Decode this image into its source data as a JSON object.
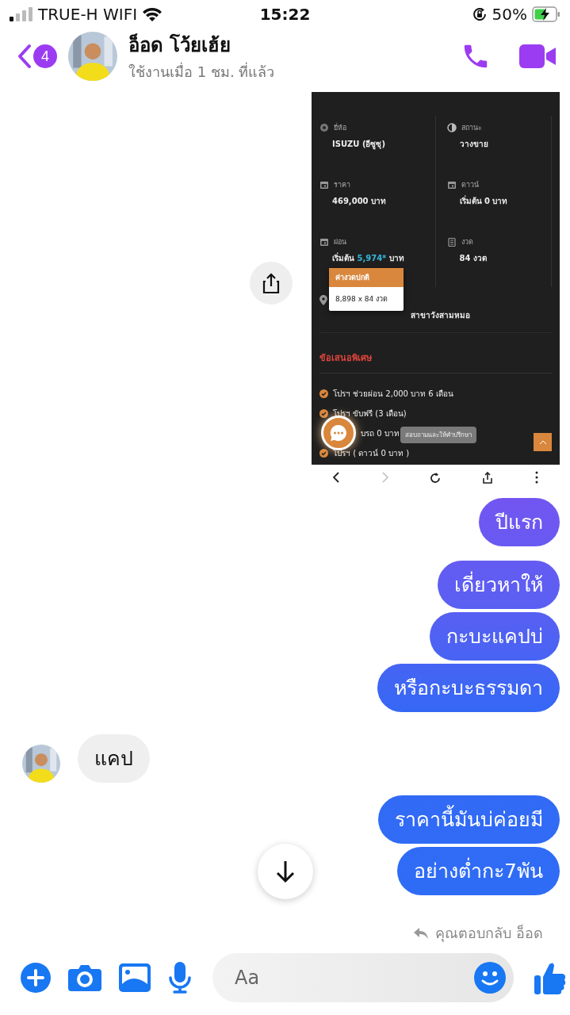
{
  "status_bar": {
    "carrier": "TRUE-H WIFI",
    "time": "15:22",
    "battery": "50%"
  },
  "header": {
    "unread_count": "4",
    "name": "อ็อด โว้ยเฮ้ย",
    "status": "ใช้งานเมื่อ 1 ชม. ที่แล้ว"
  },
  "shared_screenshot": {
    "fields": [
      {
        "label": "ยี่ห้อ",
        "value": "ISUZU (อีซูซุ)"
      },
      {
        "label": "สถานะ",
        "value": "วางขาย"
      },
      {
        "label": "ราคา",
        "value": "469,000 บาท"
      },
      {
        "label": "ดาวน์",
        "value": "เริ่มต้น 0 บาท"
      },
      {
        "label": "ผ่อน",
        "value": "เริ่มต้น",
        "highlight": "5,974*",
        "suffix": "บาท"
      },
      {
        "label": "งวด",
        "value": "84 งวด"
      }
    ],
    "location": "สาขาวังสามหมอ",
    "popup": {
      "title": "ค่างวดปกติ",
      "body": "8,898 x 84 งวด"
    },
    "offers_title": "ข้อเสนอพิเศษ",
    "offers": [
      "โปรฯ ช่วยผ่อน 2,000 บาท 6 เดือน",
      "โปรฯ ขับฟรี (3 เดือน)",
      "บรถ 0 บาท",
      "โปรฯ ( ดาวน์ 0 บาท )"
    ],
    "chat_tooltip": "สอบถามและให้คำปรึกษา",
    "browser_toolbar": [
      {
        "kind": "back",
        "disabled": false
      },
      {
        "kind": "forward",
        "disabled": true
      },
      {
        "kind": "reload",
        "disabled": false
      },
      {
        "kind": "share",
        "disabled": false
      },
      {
        "kind": "more",
        "disabled": false
      }
    ]
  },
  "messages": [
    {
      "outgoing": true,
      "text": "ปีแรก"
    },
    {
      "outgoing": true,
      "text": "เดี่ยวหาให้"
    },
    {
      "outgoing": true,
      "text": "กะบะแคปบ่"
    },
    {
      "outgoing": true,
      "text": "หรือกะบะธรรมดา"
    },
    {
      "outgoing": false,
      "text": "แคป"
    },
    {
      "outgoing": true,
      "text": "ราคานี้มันบ่ค่อยมี"
    },
    {
      "outgoing": true,
      "text": "อย่างต่ำกะ7พัน"
    }
  ],
  "reply_note": "คุณตอบกลับ อ็อด",
  "composer": {
    "placeholder": "Aa"
  }
}
